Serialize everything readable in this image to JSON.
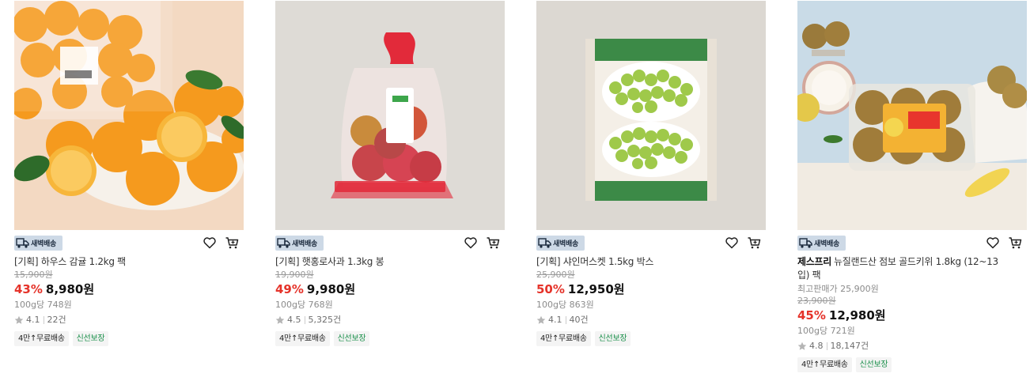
{
  "products": [
    {
      "badge": "새벽배송",
      "brand": "",
      "title": "[기획] 하우스 감귤 1.2kg 팩",
      "max_price": "",
      "original_price": "15,900원",
      "discount": "43%",
      "sale_price": "8,980원",
      "unit_price": "100g당 748원",
      "rating": "4.1",
      "reviews": "22건",
      "tags": [
        "4만↑무료배송",
        "신선보장"
      ],
      "image_icon": "tangerine-product-photo"
    },
    {
      "badge": "새벽배송",
      "brand": "",
      "title": "[기획] 햇홍로사과 1.3kg 봉",
      "max_price": "",
      "original_price": "19,900원",
      "discount": "49%",
      "sale_price": "9,980원",
      "unit_price": "100g당 768원",
      "rating": "4.5",
      "reviews": "5,325건",
      "tags": [
        "4만↑무료배송",
        "신선보장"
      ],
      "image_icon": "apple-bag-product-photo"
    },
    {
      "badge": "새벽배송",
      "brand": "",
      "title": "[기획] 샤인머스켓 1.5kg 박스",
      "max_price": "",
      "original_price": "25,900원",
      "discount": "50%",
      "sale_price": "12,950원",
      "unit_price": "100g당 863원",
      "rating": "4.1",
      "reviews": "40건",
      "tags": [
        "4만↑무료배송",
        "신선보장"
      ],
      "image_icon": "grape-box-product-photo"
    },
    {
      "badge": "새벽배송",
      "brand": "제스프리",
      "title": "뉴질랜드산 점보 골드키위 1.8kg (12~13입) 팩",
      "max_price": "최고판매가 25,900원",
      "original_price": "23,900원",
      "discount": "45%",
      "sale_price": "12,980원",
      "unit_price": "100g당 721원",
      "rating": "4.8",
      "reviews": "18,147건",
      "tags": [
        "4만↑무료배송",
        "신선보장"
      ],
      "image_icon": "kiwi-pack-product-photo"
    }
  ],
  "colors": {
    "discount": "#e5332a",
    "badge_bg": "#cdd9e6",
    "fresh_tag": "#1a8f4a"
  }
}
